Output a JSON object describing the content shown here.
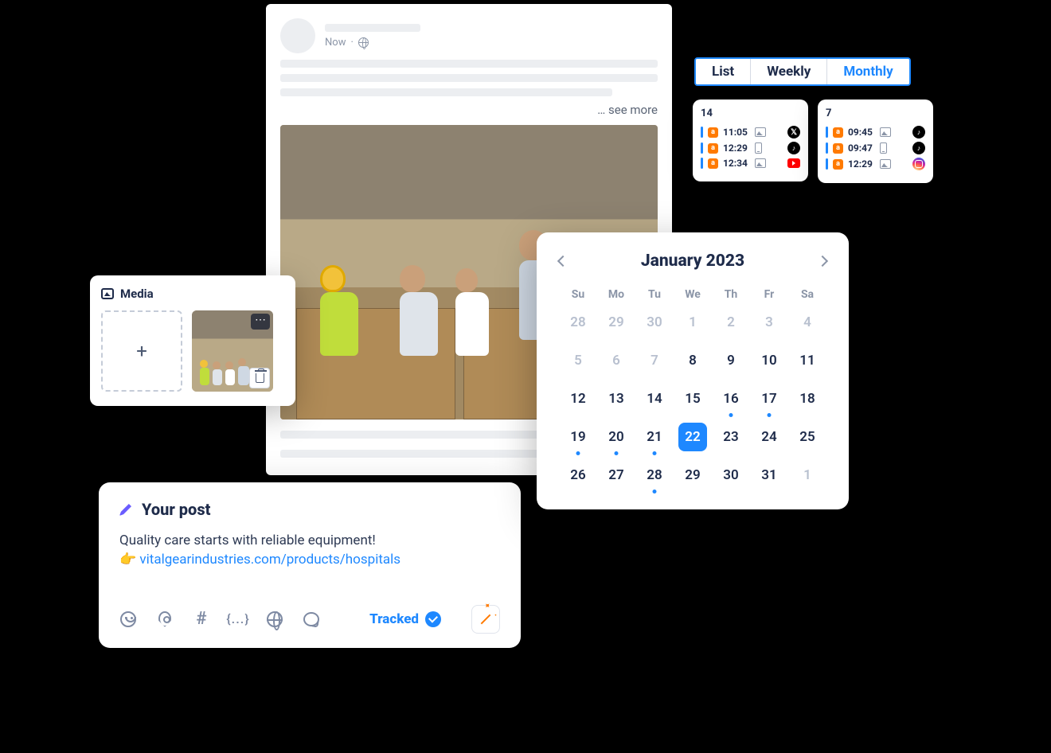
{
  "post_preview": {
    "time_label": "Now",
    "see_more": "… see more"
  },
  "media_panel": {
    "title": "Media"
  },
  "your_post": {
    "title": "Your post",
    "text_line1": "Quality care starts with reliable equipment!",
    "emoji": "👉",
    "link_text": "vitalgearindustries.com/products/hospitals",
    "tracked_label": "Tracked",
    "toolbar": {
      "hash": "#",
      "brace": "{...}"
    }
  },
  "view_tabs": {
    "list": "List",
    "weekly": "Weekly",
    "monthly": "Monthly"
  },
  "day_card_a": {
    "day": "14",
    "rows": [
      {
        "time": "11:05",
        "icon": "photo",
        "platform": "x"
      },
      {
        "time": "12:29",
        "icon": "phone",
        "platform": "tiktok"
      },
      {
        "time": "12:34",
        "icon": "photo",
        "platform": "youtube"
      }
    ]
  },
  "day_card_b": {
    "day": "7",
    "rows": [
      {
        "time": "09:45",
        "icon": "photo",
        "platform": "tiktok"
      },
      {
        "time": "09:47",
        "icon": "phone",
        "platform": "tiktok"
      },
      {
        "time": "12:29",
        "icon": "photo",
        "platform": "instagram"
      }
    ]
  },
  "calendar": {
    "title": "January 2023",
    "weekdays": [
      "Su",
      "Mo",
      "Tu",
      "We",
      "Th",
      "Fr",
      "Sa"
    ],
    "cells": [
      {
        "n": "28",
        "muted": true
      },
      {
        "n": "29",
        "muted": true
      },
      {
        "n": "30",
        "muted": true
      },
      {
        "n": "1",
        "muted": true
      },
      {
        "n": "2",
        "muted": true
      },
      {
        "n": "3",
        "muted": true
      },
      {
        "n": "4",
        "muted": true
      },
      {
        "n": "5",
        "muted": true
      },
      {
        "n": "6",
        "muted": true
      },
      {
        "n": "7",
        "muted": true
      },
      {
        "n": "8"
      },
      {
        "n": "9"
      },
      {
        "n": "10"
      },
      {
        "n": "11"
      },
      {
        "n": "12"
      },
      {
        "n": "13"
      },
      {
        "n": "14"
      },
      {
        "n": "15"
      },
      {
        "n": "16",
        "dot": true
      },
      {
        "n": "17",
        "dot": true
      },
      {
        "n": "18"
      },
      {
        "n": "19",
        "dot": true
      },
      {
        "n": "20",
        "dot": true
      },
      {
        "n": "21",
        "dot": true
      },
      {
        "n": "22",
        "sel": true
      },
      {
        "n": "23"
      },
      {
        "n": "24"
      },
      {
        "n": "25"
      },
      {
        "n": "26"
      },
      {
        "n": "27"
      },
      {
        "n": "28",
        "dot": true
      },
      {
        "n": "29"
      },
      {
        "n": "30"
      },
      {
        "n": "31"
      },
      {
        "n": "1",
        "muted": true
      }
    ]
  }
}
